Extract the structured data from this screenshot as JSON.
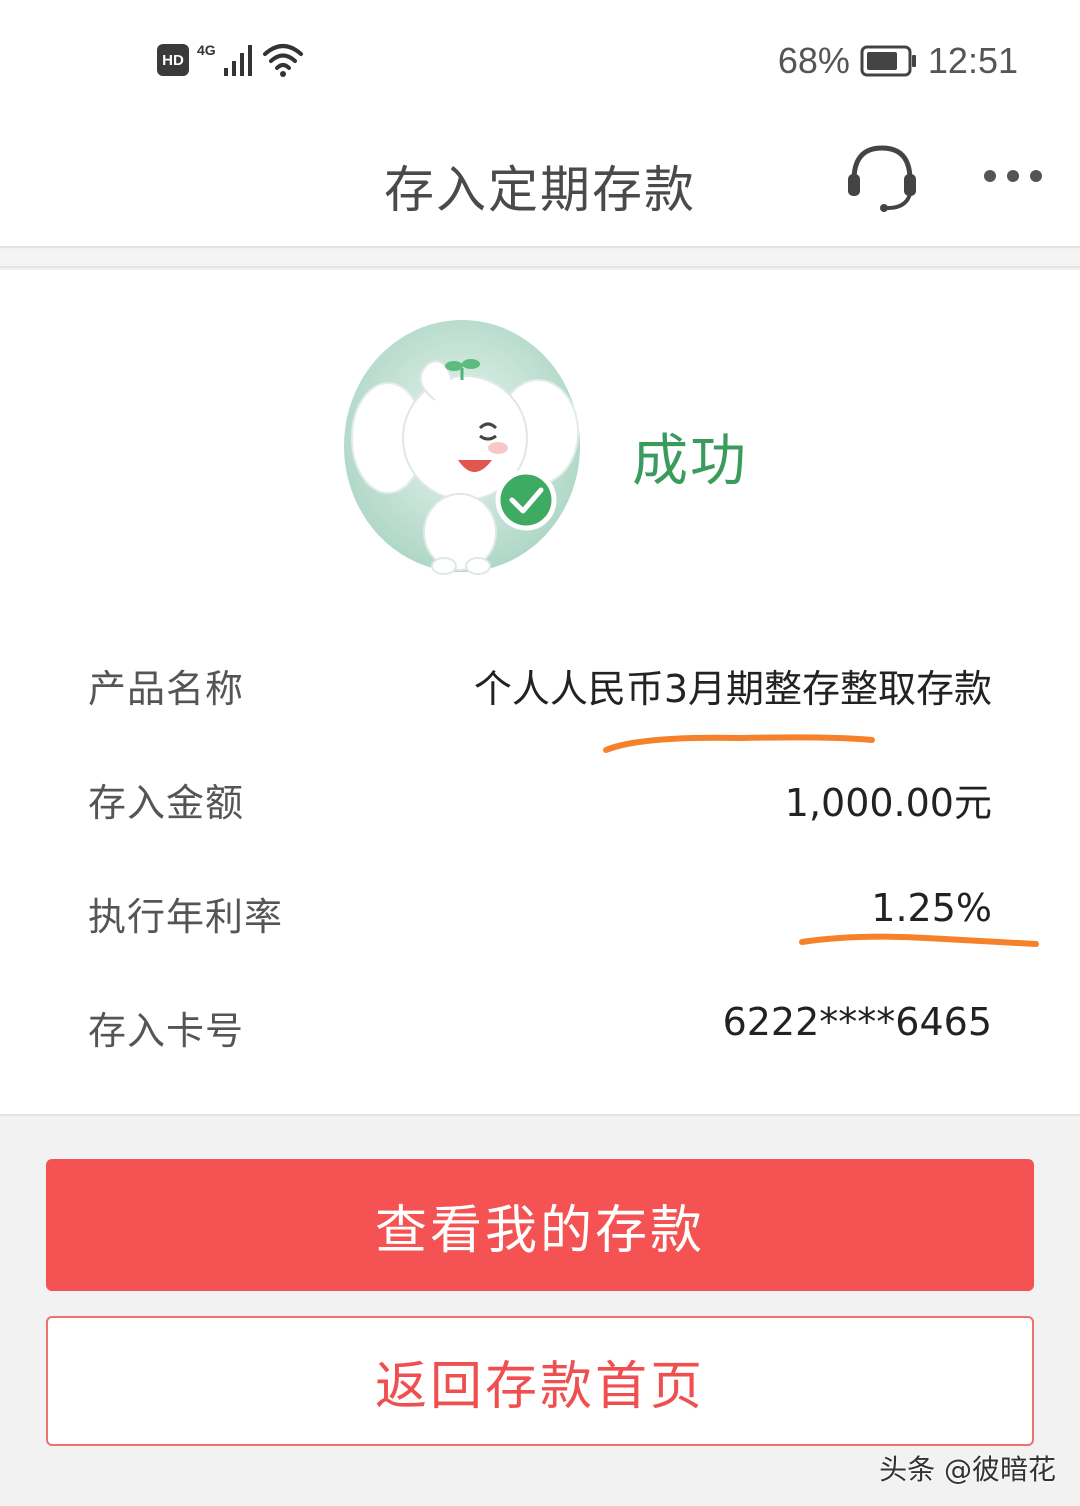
{
  "status_bar": {
    "hd": "HD",
    "network": "4G",
    "battery": "68%",
    "time": "12:51"
  },
  "header": {
    "title": "存入定期存款"
  },
  "result": {
    "status": "成功"
  },
  "details": [
    {
      "label": "产品名称",
      "value": "个人人民币3月期整存整取存款"
    },
    {
      "label": "存入金额",
      "value": "1,000.00元"
    },
    {
      "label": "执行年利率",
      "value": "1.25%"
    },
    {
      "label": "存入卡号",
      "value": "6222****6465"
    }
  ],
  "actions": {
    "primary": "查看我的存款",
    "secondary": "返回存款首页"
  },
  "watermark": "头条 @彼暗花",
  "colors": {
    "success_green": "#3a9c5c",
    "primary_red": "#f55353",
    "annotation_orange": "#f5822a"
  }
}
